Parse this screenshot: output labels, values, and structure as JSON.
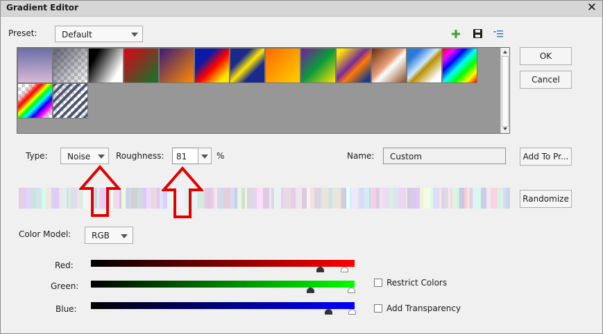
{
  "window": {
    "title": "Gradient Editor",
    "close_glyph": "✕"
  },
  "preset": {
    "label": "Preset:",
    "value": "Default"
  },
  "toolbar": {
    "add_icon": "plus-icon",
    "save_icon": "save-icon",
    "menu_icon": "list-menu-icon"
  },
  "buttons": {
    "ok": "OK",
    "cancel": "Cancel",
    "add_to_preset": "Add To Pr...",
    "randomize": "Randomize"
  },
  "type": {
    "label": "Type:",
    "value": "Noise"
  },
  "roughness": {
    "label": "Roughness:",
    "value": "81",
    "unit": "%"
  },
  "name": {
    "label": "Name:",
    "value": "Custom"
  },
  "color_model": {
    "label": "Color Model:",
    "value": "RGB"
  },
  "channels": [
    {
      "label": "Red:",
      "color": "#ff0000"
    },
    {
      "label": "Green:",
      "color": "#00ff00"
    },
    {
      "label": "Blue:",
      "color": "#0000ff"
    }
  ],
  "options": {
    "restrict_colors": "Restrict Colors",
    "add_transparency": "Add Transparency"
  },
  "colors": {
    "annotation_arrow": "#e00000"
  }
}
